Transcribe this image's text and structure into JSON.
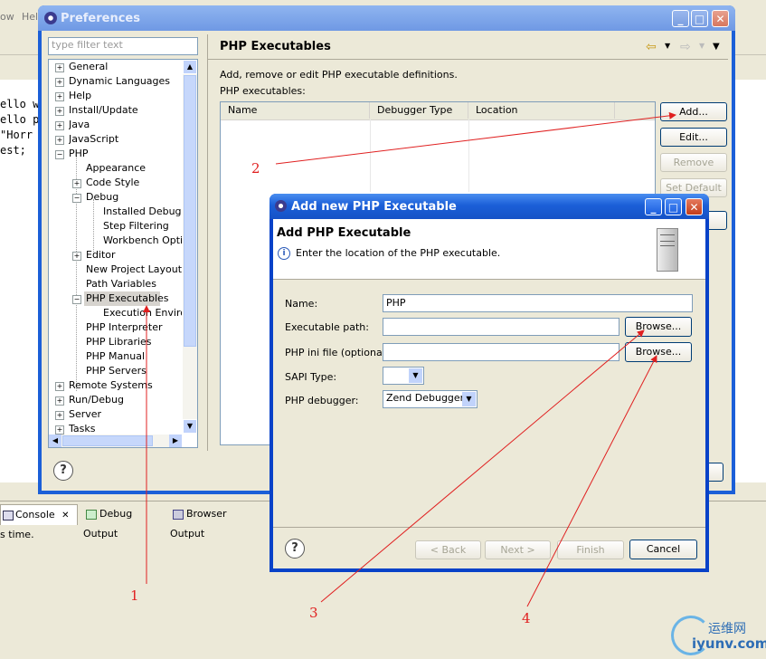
{
  "ide": {
    "menu_partial": [
      "ow",
      "Help"
    ],
    "code_lines": [
      "ello w",
      "ello p",
      "\"Horr",
      "est;"
    ],
    "console_tabs": [
      {
        "label": "Console",
        "close": "✕"
      },
      {
        "label": "Debug Output"
      },
      {
        "label": "Browser Output"
      }
    ],
    "console_text": "s time."
  },
  "preferences": {
    "title": "Preferences",
    "filter_placeholder": "type filter text",
    "tree": [
      {
        "label": "General",
        "pm": "+"
      },
      {
        "label": "Dynamic Languages",
        "pm": "+"
      },
      {
        "label": "Help",
        "pm": "+"
      },
      {
        "label": "Install/Update",
        "pm": "+"
      },
      {
        "label": "Java",
        "pm": "+"
      },
      {
        "label": "JavaScript",
        "pm": "+"
      },
      {
        "label": "PHP",
        "pm": "−"
      },
      {
        "label": "Appearance",
        "pm": ""
      },
      {
        "label": "Code Style",
        "pm": "+"
      },
      {
        "label": "Debug",
        "pm": "−"
      },
      {
        "label": "Installed Debugge",
        "pm": ""
      },
      {
        "label": "Step Filtering",
        "pm": ""
      },
      {
        "label": "Workbench Optior",
        "pm": ""
      },
      {
        "label": "Editor",
        "pm": "+"
      },
      {
        "label": "New Project Layout",
        "pm": ""
      },
      {
        "label": "Path Variables",
        "pm": ""
      },
      {
        "label": "PHP Executables",
        "pm": "−",
        "selected": true
      },
      {
        "label": "Execution Environ",
        "pm": ""
      },
      {
        "label": "PHP Interpreter",
        "pm": ""
      },
      {
        "label": "PHP Libraries",
        "pm": ""
      },
      {
        "label": "PHP Manual",
        "pm": ""
      },
      {
        "label": "PHP Servers",
        "pm": ""
      },
      {
        "label": "Remote Systems",
        "pm": "+"
      },
      {
        "label": "Run/Debug",
        "pm": "+"
      },
      {
        "label": "Server",
        "pm": "+"
      },
      {
        "label": "Tasks",
        "pm": "+"
      }
    ],
    "page_title": "PHP Executables",
    "description": "Add, remove or edit PHP executable definitions.",
    "table_label": "PHP executables:",
    "columns": [
      "Name",
      "Debugger Type",
      "Location"
    ],
    "buttons": {
      "add": "Add...",
      "edit": "Edit...",
      "remove": "Remove",
      "set_default": "Set Default"
    }
  },
  "dialog": {
    "title": "Add new PHP Executable",
    "heading": "Add PHP Executable",
    "info": "Enter the location of the PHP executable.",
    "name_label": "Name:",
    "name_value": "PHP",
    "exe_label": "Executable path:",
    "exe_value": "",
    "ini_label": "PHP ini file (optional):",
    "ini_value": "",
    "browse1": "Browse...",
    "browse2": "Browse...",
    "sapi_label": "SAPI Type:",
    "sapi_value": "",
    "debugger_label": "PHP debugger:",
    "debugger_value": "Zend Debugger",
    "back": "< Back",
    "next": "Next >",
    "finish": "Finish",
    "cancel": "Cancel"
  },
  "annotations": [
    "1",
    "2",
    "3",
    "4"
  ],
  "watermark": {
    "cn": "运维网",
    "url": "iyunv.com"
  },
  "colors": {
    "annotation": "#e02020",
    "xp_title": "#1b5fd8",
    "selection": "#d6d3ce"
  }
}
